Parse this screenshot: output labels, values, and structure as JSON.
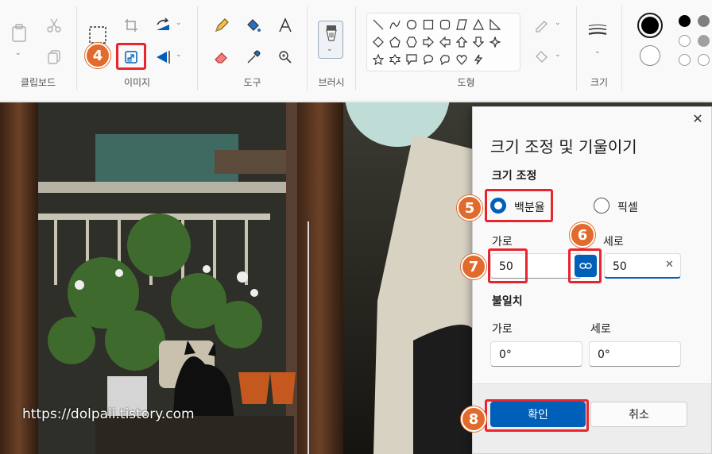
{
  "ribbon": {
    "groups": {
      "clipboard": "클립보드",
      "image": "이미지",
      "tools": "도구",
      "brushes": "브러시",
      "shapes": "도형",
      "size": "크기"
    }
  },
  "dialog": {
    "title": "크기 조정 및 기울이기",
    "resize_section": "크기 조정",
    "percent_label": "백분율",
    "pixel_label": "픽셀",
    "horizontal_label": "가로",
    "vertical_label": "세로",
    "horizontal_value": "50",
    "vertical_value": "50",
    "skew_section": "불일치",
    "skew_horizontal_label": "가로",
    "skew_vertical_label": "세로",
    "skew_horizontal_value": "0°",
    "skew_vertical_value": "0°",
    "ok_label": "확인",
    "cancel_label": "취소",
    "selected_mode": "percent",
    "aspect_lock": true
  },
  "annotations": {
    "step4": "4",
    "step5": "5",
    "step6": "6",
    "step7": "7",
    "step8": "8"
  },
  "watermark": "https://dolpali.tistory.com",
  "colors": {
    "accent": "#005fb8",
    "highlight": "#e8242e",
    "badge": "#e06b2c"
  }
}
